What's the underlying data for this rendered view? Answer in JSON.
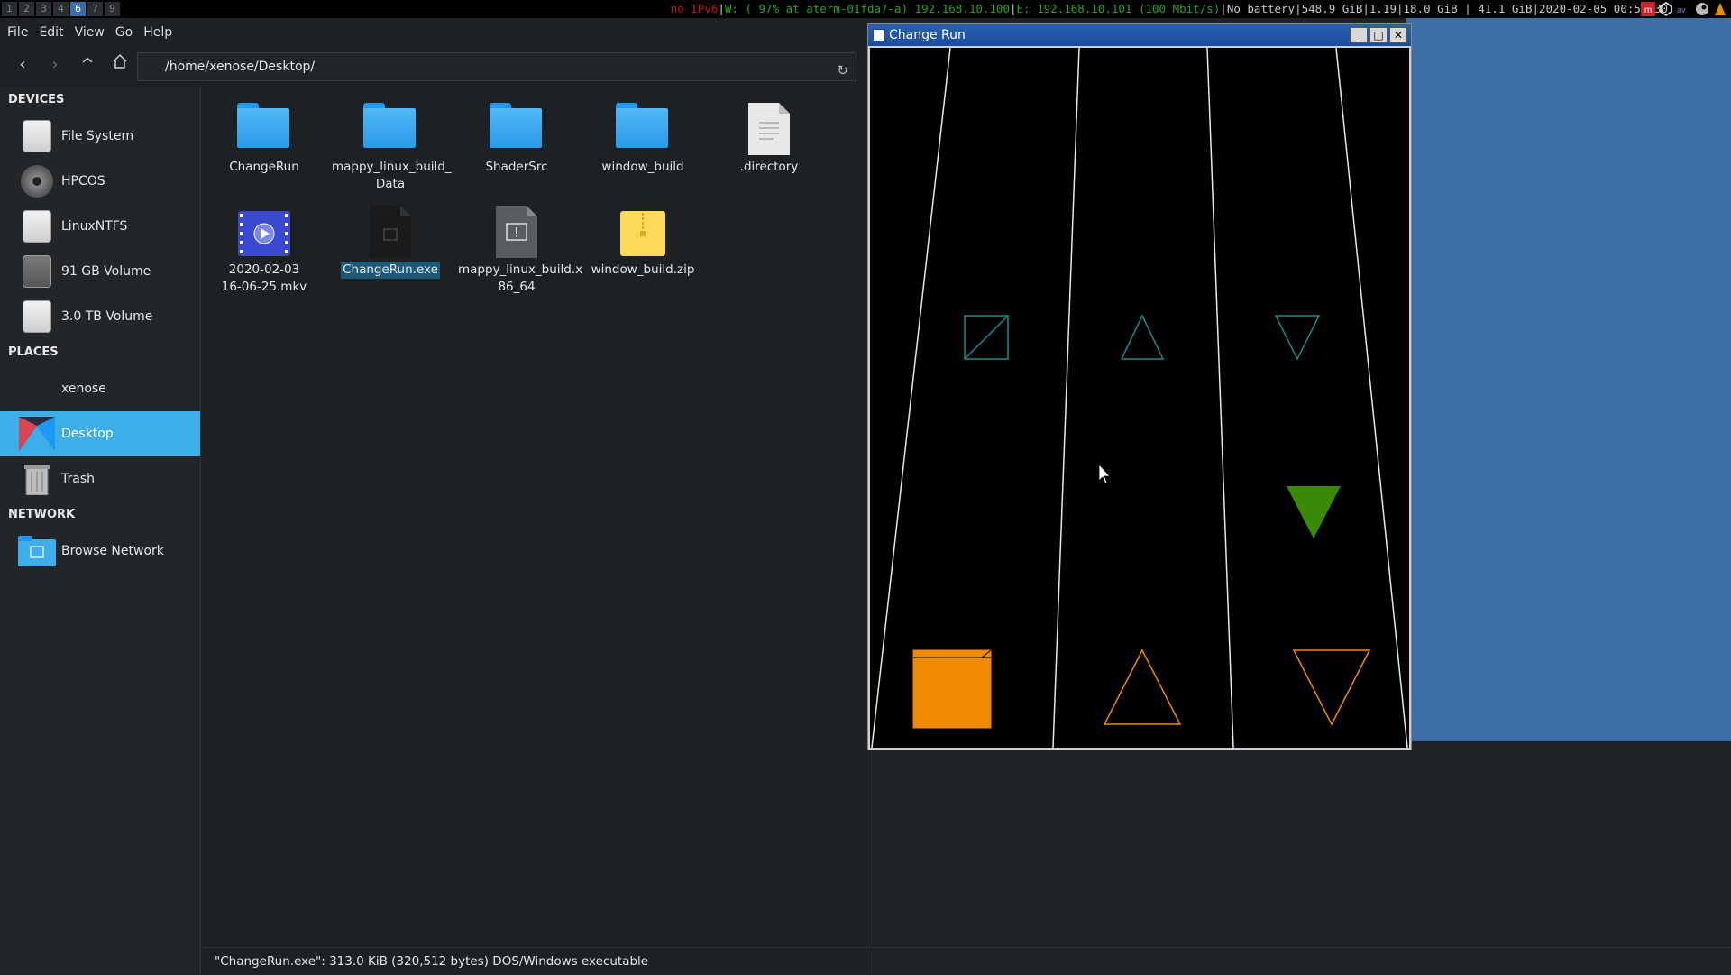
{
  "topbar": {
    "workspaces": [
      "1",
      "2",
      "3",
      "4",
      "6",
      "7",
      "9"
    ],
    "active_workspace": "6",
    "status_ipv6": "no IPv6",
    "status_wifi": "W: ( 97% at aterm-01fda7-a) 192.168.10.100",
    "status_eth": "E: 192.168.10.101 (100 Mbit/s)",
    "status_rest": "No battery|548.9 GiB|1.19|18.0 GiB | 41.1 GiB|2020-02-05 00:57:30"
  },
  "filemanager": {
    "menu": [
      "File",
      "Edit",
      "View",
      "Go",
      "Help"
    ],
    "path": "/home/xenose/Desktop/",
    "sidebar": {
      "devices_title": "DEVICES",
      "devices": [
        "File System",
        "HPCOS",
        "LinuxNTFS",
        "91 GB Volume",
        "3.0 TB Volume"
      ],
      "places_title": "PLACES",
      "places": [
        "xenose",
        "Desktop",
        "Trash"
      ],
      "network_title": "NETWORK",
      "network": [
        "Browse Network"
      ]
    },
    "files": [
      {
        "name": "ChangeRun"
      },
      {
        "name": "mappy_linux_build_\nData"
      },
      {
        "name": "ShaderSrc"
      },
      {
        "name": "window_build"
      },
      {
        "name": ".directory"
      },
      {
        "name": "2020-02-03\n16-06-25.mkv"
      },
      {
        "name": "ChangeRun.exe"
      },
      {
        "name": "mappy_linux_build.x\n86_64"
      },
      {
        "name": "window_build.zip"
      }
    ],
    "statusbar": "\"ChangeRun.exe\": 313.0 KiB (320,512 bytes) DOS/Windows executable"
  },
  "game": {
    "title": "Change Run",
    "colors": {
      "teal": "#1a8a8a",
      "orange": "#f08a00",
      "green": "#3a8a08",
      "lane": "#e8e8e8"
    }
  }
}
